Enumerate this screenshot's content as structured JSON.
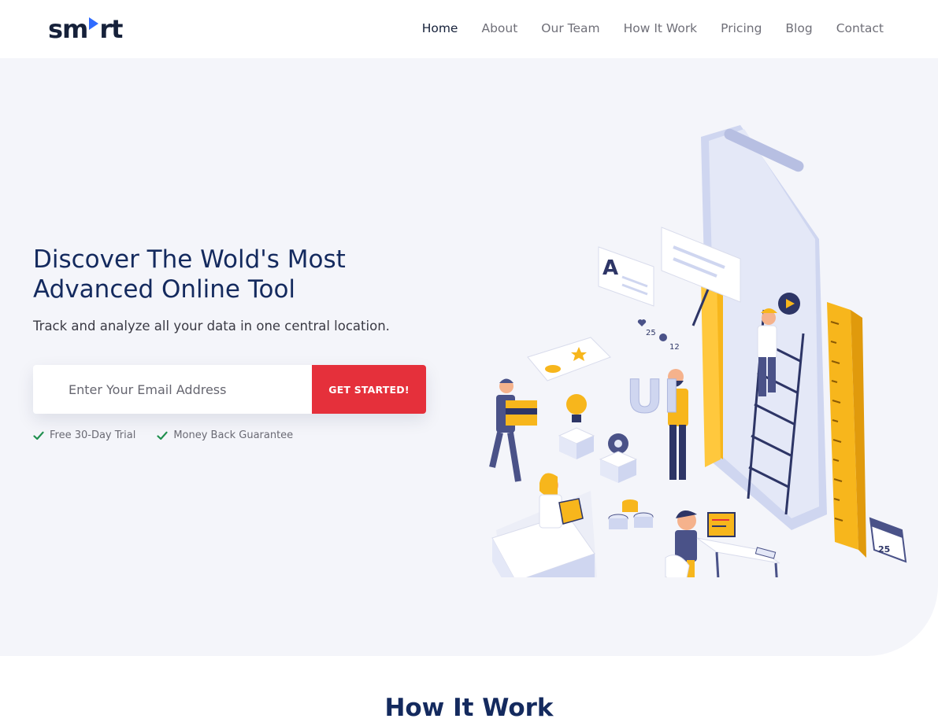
{
  "brand": {
    "logo_text_left": "sm",
    "logo_text_right": "rt"
  },
  "nav": {
    "items": [
      {
        "label": "Home",
        "active": true
      },
      {
        "label": "About"
      },
      {
        "label": "Our Team"
      },
      {
        "label": "How It Work"
      },
      {
        "label": "Pricing"
      },
      {
        "label": "Blog"
      },
      {
        "label": "Contact"
      }
    ]
  },
  "hero": {
    "title": "Discover The Wold's Most Advanced Online Tool",
    "subtitle": "Track and analyze all your data in one central location.",
    "email_placeholder": "Enter Your Email Address",
    "cta_label": "GET STARTED!",
    "features": [
      "Free 30-Day Trial",
      "Money Back Guarantee"
    ],
    "illustration_labels": {
      "likes": "25",
      "comments": "12",
      "calendar": "25",
      "ui_letters": "UI",
      "card_letter": "A"
    }
  },
  "colors": {
    "primary": "#142a5e",
    "accent": "#e5303b",
    "brand_blue": "#2f6bff",
    "hero_bg": "#f4f5fa",
    "check": "#1f8f4e",
    "illus_yellow": "#f7b61c"
  },
  "section": {
    "title": "How It Work"
  }
}
